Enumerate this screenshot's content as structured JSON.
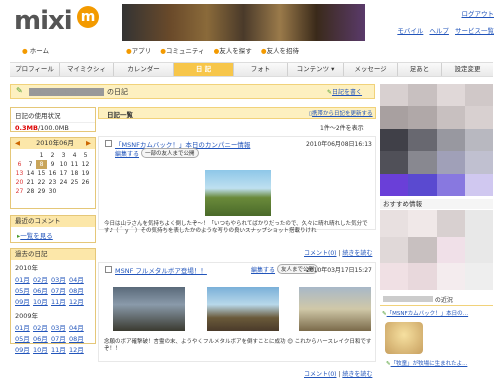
{
  "brand": {
    "logo_text": "mixi",
    "logo_mark": "m"
  },
  "header": {
    "login_link": "ログアウト",
    "links": [
      "モバイル",
      "ヘルプ",
      "サービス一覧"
    ]
  },
  "subnav": {
    "home": "ホーム",
    "items": [
      "アプリ",
      "コミュニティ",
      "友人を探す",
      "友人を招待"
    ]
  },
  "mainnav": {
    "tabs": [
      "プロフィール",
      "マイミクシィ",
      "カレンダー",
      "日 記",
      "フォト",
      "コンテンツ ▾",
      "メッセージ",
      "足あと",
      "設定変更"
    ],
    "active_index": 3
  },
  "diary_header": {
    "owner_name": "■■■■ ■■■■",
    "title_suffix": "の日記",
    "write_link": "日記を書く",
    "list_title": "日記一覧",
    "view_link": "携帯から日記を更新する",
    "count": "1件〜2件を表示"
  },
  "sidebar": {
    "usage": {
      "title": "日記の使用状況",
      "used": "0.3MB",
      "total": "/100.0MB"
    },
    "calendar": {
      "title": "2010年06月",
      "weeks": [
        [
          "",
          "",
          "1",
          "2",
          "3",
          "4",
          "5"
        ],
        [
          "6",
          "7",
          "8",
          "9",
          "10",
          "11",
          "12"
        ],
        [
          "13",
          "14",
          "15",
          "16",
          "17",
          "18",
          "19"
        ],
        [
          "20",
          "21",
          "22",
          "23",
          "24",
          "25",
          "26"
        ],
        [
          "27",
          "28",
          "29",
          "30",
          "",
          "",
          ""
        ]
      ],
      "highlight": "8"
    },
    "recent_comments": {
      "title": "最近のコメント",
      "link": "一覧を見る"
    },
    "past": {
      "title": "過去の日記",
      "year1": "2010年",
      "months1": [
        "01月",
        "02月",
        "03月",
        "04月",
        "05月",
        "06月",
        "07月",
        "08月",
        "09月",
        "10月",
        "11月",
        "12月"
      ],
      "year2": "2009年",
      "months2": [
        "01月",
        "02月",
        "03月",
        "04月",
        "05月",
        "06月",
        "07月",
        "08月",
        "09月",
        "10月",
        "11月",
        "12月"
      ]
    }
  },
  "entries": [
    {
      "title": "「MSNFカムバック！」本日のカンパニー情報",
      "date": "2010年06月08日16:13",
      "edit": "編集する",
      "visibility": "一部の友人まで公開",
      "body": "今日は山ラさんを気持ちよく倒したぞ～！「いつもやられてばかりだったので、久々に晴れ晴れした気分です♪（＾ｙ＾）その気持ちを表したかのような写りの良いスナップショット搭載りけれ",
      "comments": "コメント(0)",
      "more": "続きを読む"
    },
    {
      "title": "MSNF フルメタルボア登場！！",
      "date": "2010年03月17日15:27",
      "edit": "編集する",
      "visibility": "友人まで公開",
      "body": "念願のボア確撃破！言霊の末、ようやくフルメタルボアを倒すことに成功 😊 これからハースレイク日和ですぞ！！",
      "comments": "コメント(0)",
      "more": "続きを読む"
    }
  ],
  "right": {
    "recommend": "おすすめ情報",
    "recent_title": "の近況",
    "recent_items": [
      "「MSNFカムバック！」本日の…",
      "「牧童」が牧場に生まれたよ..."
    ]
  }
}
